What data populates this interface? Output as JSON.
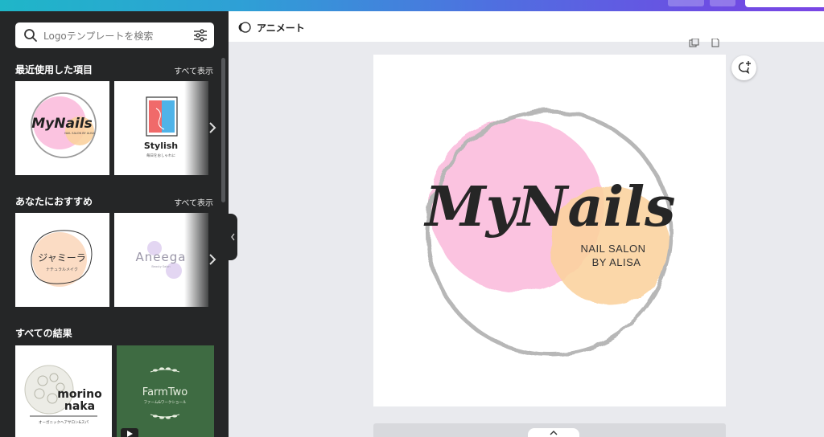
{
  "search": {
    "placeholder": "Logoテンプレートを検索"
  },
  "sections": {
    "recent": {
      "title": "最近使用した項目",
      "see_all": "すべて表示"
    },
    "recommended": {
      "title": "あなたにおすすめ",
      "see_all": "すべて表示"
    },
    "all_results": {
      "title": "すべての結果"
    }
  },
  "templates": {
    "recent": [
      {
        "name": "MyNails",
        "subtitle": "NAIL SALON BY ALISA"
      },
      {
        "name": "Stylish",
        "subtitle": "毎日をおしゃれに"
      }
    ],
    "recommended": [
      {
        "name": "ジャミーラ",
        "subtitle": "ナチュラルメイク"
      },
      {
        "name": "Aneega",
        "subtitle": "Beauty Salon"
      }
    ],
    "all": [
      {
        "name_line1": "morino",
        "name_line2": "naka",
        "subtitle": "オーガニックヘアサロン&スパ"
      },
      {
        "name": "FarmTwo",
        "subtitle": "ファーム&ワークショール"
      }
    ]
  },
  "editor": {
    "animate_label": "アニメート"
  },
  "logo": {
    "title": "MyNails",
    "line1": "NAIL SALON",
    "line2": "BY ALISA"
  },
  "colors": {
    "pink": "#fbc3e0",
    "peach": "#fbd29e",
    "dark_panel": "#252627",
    "farm_green": "#3e6b42"
  }
}
